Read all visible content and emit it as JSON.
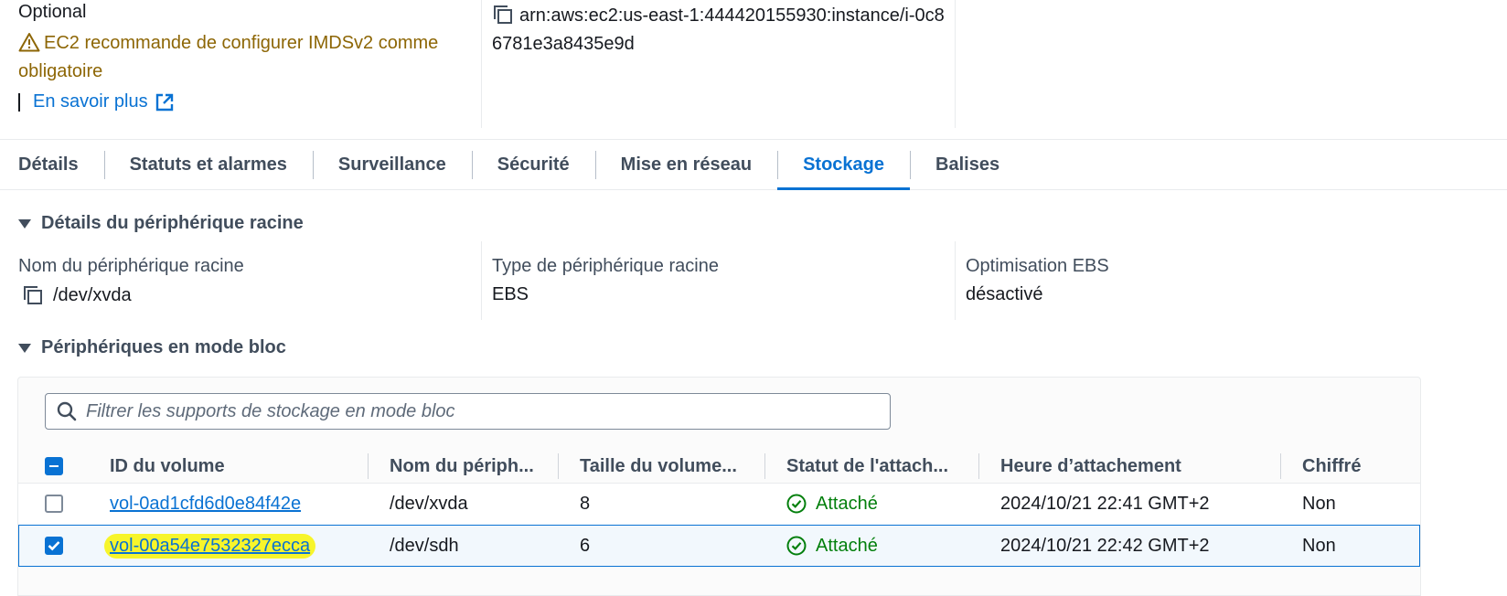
{
  "top": {
    "optional_label": "Optional",
    "warning_text": "EC2 recommande de configurer IMDSv2 comme obligatoire",
    "learn_more": "En savoir plus",
    "arn": "arn:aws:ec2:us-east-1:444420155930:instance/i-0c86781e3a8435e9d"
  },
  "tabs": [
    {
      "label": "Détails"
    },
    {
      "label": "Statuts et alarmes"
    },
    {
      "label": "Surveillance"
    },
    {
      "label": "Sécurité"
    },
    {
      "label": "Mise en réseau"
    },
    {
      "label": "Stockage",
      "active": true
    },
    {
      "label": "Balises"
    }
  ],
  "root_device": {
    "section_title": "Détails du périphérique racine",
    "name_label": "Nom du périphérique racine",
    "name_value": "/dev/xvda",
    "type_label": "Type de périphérique racine",
    "type_value": "EBS",
    "ebs_label": "Optimisation EBS",
    "ebs_value": "désactivé"
  },
  "block_devices": {
    "section_title": "Périphériques en mode bloc",
    "search_placeholder": "Filtrer les supports de stockage en mode bloc",
    "columns": [
      "ID du volume",
      "Nom du périph...",
      "Taille du volume...",
      "Statut de l'attach...",
      "Heure d’attachement",
      "Chiffré"
    ],
    "rows": [
      {
        "volume_id": "vol-0ad1cfd6d0e84f42e",
        "device": "/dev/xvda",
        "size": "8",
        "status": "Attaché",
        "time": "2024/10/21 22:41 GMT+2",
        "encrypted": "Non",
        "selected": false
      },
      {
        "volume_id": "vol-00a54e7532327ecca",
        "device": "/dev/sdh",
        "size": "6",
        "status": "Attaché",
        "time": "2024/10/21 22:42 GMT+2",
        "encrypted": "Non",
        "selected": true
      }
    ]
  },
  "colors": {
    "link": "#0972d3",
    "warning": "#8d6605",
    "success": "#037f0c",
    "highlight": "#f7f52b"
  }
}
